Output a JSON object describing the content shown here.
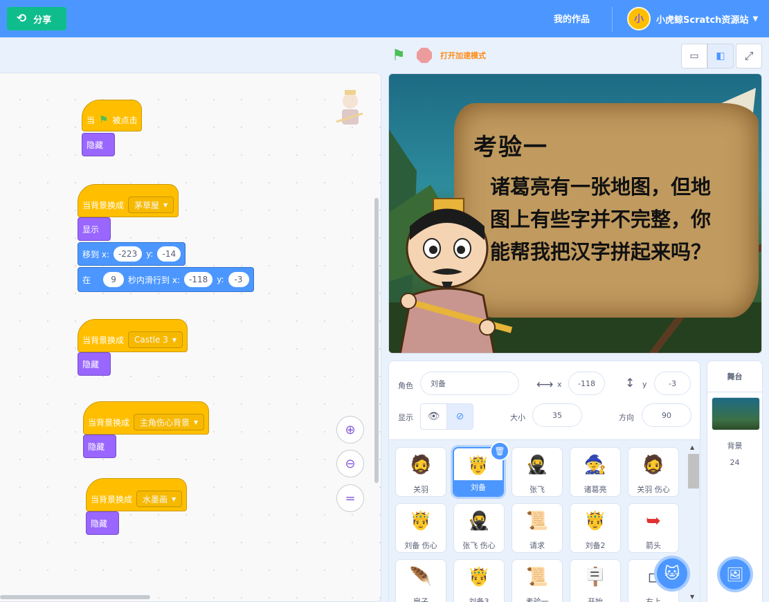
{
  "menu": {
    "share_label": "分享",
    "my_works": "我的作品",
    "account_name": "小虎鲸Scratch资源站",
    "avatar_text": "小"
  },
  "stage_header": {
    "turbo_label": "打开加速模式"
  },
  "scripts": [
    {
      "hat": {
        "prefix": "当",
        "suffix": "被点击"
      },
      "body": [
        "隐藏"
      ]
    },
    {
      "hat": {
        "prefix": "当背景换成",
        "backdrop": "茅草屋"
      },
      "body": {
        "show": "显示",
        "goto": {
          "label_x": "移到 x:",
          "x": "-223",
          "label_y": "y:",
          "y": "-14"
        },
        "glide": {
          "label_in": "在",
          "secs": "9",
          "label_mid": "秒内滑行到 x:",
          "x": "-118",
          "label_y": "y:",
          "y": "-3"
        }
      }
    },
    {
      "hat": {
        "prefix": "当背景换成",
        "backdrop": "Castle 3"
      },
      "body": [
        "隐藏"
      ]
    },
    {
      "hat": {
        "prefix": "当背景换成",
        "backdrop": "主角伤心背景"
      },
      "body": [
        "隐藏"
      ]
    },
    {
      "hat": {
        "prefix": "当背景换成",
        "backdrop": "水墨画"
      },
      "body": [
        "隐藏"
      ]
    }
  ],
  "stage": {
    "title": "考验一",
    "text": "诸葛亮有一张地图，但地图上有些字并不完整，你能帮我把汉字拼起来吗？"
  },
  "sprite_info": {
    "sprite_label": "角色",
    "sprite_name": "刘备",
    "x_label": "x",
    "x": "-118",
    "y_label": "y",
    "y": "-3",
    "show_label": "显示",
    "size_label": "大小",
    "size": "35",
    "direction_label": "方向",
    "direction": "90"
  },
  "sprites": [
    {
      "name": "关羽",
      "icon": "🧔"
    },
    {
      "name": "刘备",
      "icon": "🤴",
      "selected": true
    },
    {
      "name": "张飞",
      "icon": "🥷"
    },
    {
      "name": "诸葛亮",
      "icon": "🧙"
    },
    {
      "name": "关羽 伤心",
      "icon": "🧔"
    },
    {
      "name": "刘备 伤心",
      "icon": "🤴"
    },
    {
      "name": "张飞 伤心",
      "icon": "🥷"
    },
    {
      "name": "请求",
      "icon": "📜"
    },
    {
      "name": "刘备2",
      "icon": "🤴"
    },
    {
      "name": "箭头",
      "icon": "➥"
    },
    {
      "name": "扇子",
      "icon": "🪶"
    },
    {
      "name": "刘备3",
      "icon": "🤴"
    },
    {
      "name": "考验一",
      "icon": "📜"
    },
    {
      "name": "开始",
      "icon": "🪧"
    },
    {
      "name": "右上",
      "icon": "▫"
    }
  ],
  "stage_target": {
    "title": "舞台",
    "backdrop_label": "背景",
    "backdrop_count": "24"
  },
  "colors": {
    "menu_blue": "#4c97ff",
    "share_green": "#0fbd8c",
    "event_yellow": "#ffbf00",
    "looks_purple": "#9966ff",
    "motion_blue": "#4c97ff",
    "turbo_orange": "#ff8c1a"
  }
}
